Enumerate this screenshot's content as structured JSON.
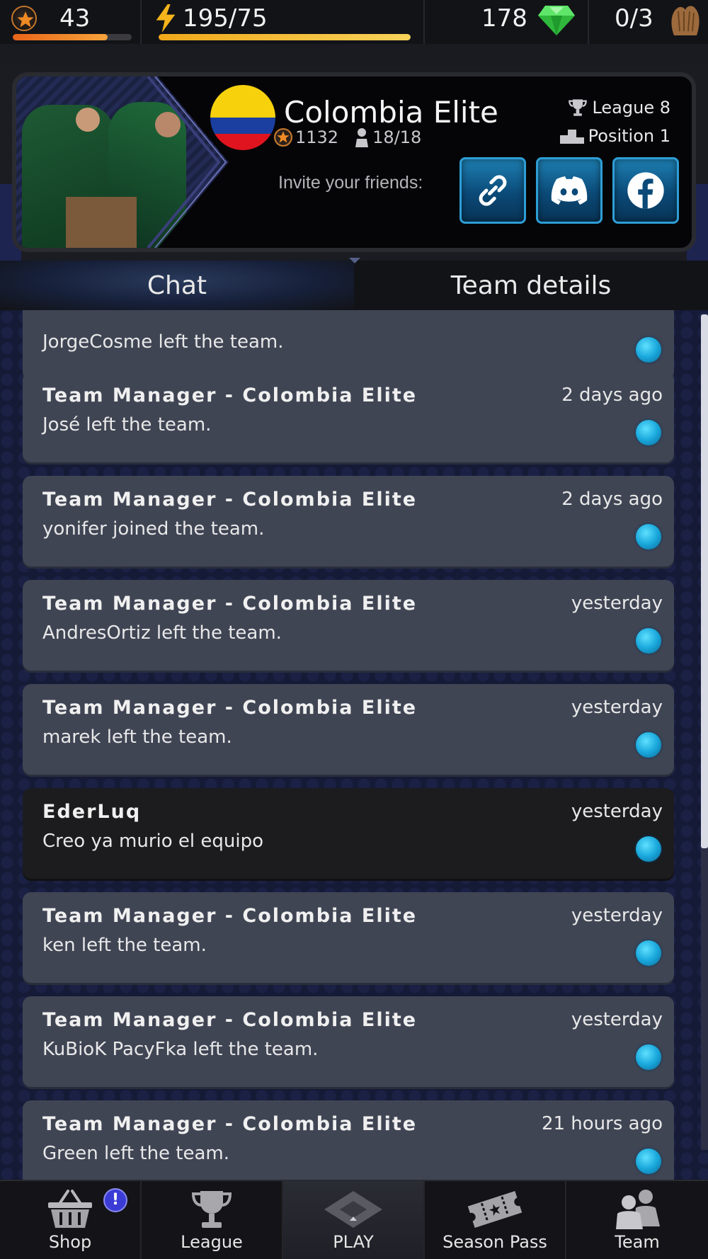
{
  "status_bar": {
    "level": "43",
    "level_progress": 0.8,
    "energy": "195/75",
    "energy_progress": 1.0,
    "gems": "178",
    "gloves": "0/3",
    "colors": {
      "level_bar": "#f07a1c",
      "energy_bar": "#f0b020",
      "gem": "#3cd04a"
    }
  },
  "team": {
    "name": "Colombia Elite",
    "rating": "1132",
    "members": "18/18",
    "league": "League 8",
    "position": "Position 1",
    "invite_label": "Invite your friends:",
    "share_buttons": [
      "link-icon",
      "discord-icon",
      "facebook-icon"
    ]
  },
  "tabs": [
    {
      "label": "Chat",
      "active": true
    },
    {
      "label": "Team details",
      "active": false
    }
  ],
  "messages": [
    {
      "author": "",
      "time": "",
      "text": "JorgeCosme left the team.",
      "kind": "system"
    },
    {
      "author": "Team Manager - Colombia Elite",
      "time": "2 days ago",
      "text": "José  left the team.",
      "kind": "system"
    },
    {
      "author": "Team Manager - Colombia Elite",
      "time": "2 days ago",
      "text": "yonifer  joined the team.",
      "kind": "system"
    },
    {
      "author": "Team Manager - Colombia Elite",
      "time": "yesterday",
      "text": "AndresOrtiz left the team.",
      "kind": "system"
    },
    {
      "author": "Team Manager - Colombia Elite",
      "time": "yesterday",
      "text": "marek left the team.",
      "kind": "system"
    },
    {
      "author": "EderLuq",
      "time": "yesterday",
      "text": "Creo ya murio el equipo",
      "kind": "player"
    },
    {
      "author": "Team Manager - Colombia Elite",
      "time": "yesterday",
      "text": "ken  left the team.",
      "kind": "system"
    },
    {
      "author": "Team Manager - Colombia Elite",
      "time": "yesterday",
      "text": "KuBioK PacyFka left the team.",
      "kind": "system"
    },
    {
      "author": "Team Manager - Colombia Elite",
      "time": "21 hours ago",
      "text": "Green left the team.",
      "kind": "system"
    }
  ],
  "nav": [
    {
      "label": "Shop",
      "icon": "basket-icon",
      "badge": "!"
    },
    {
      "label": "League",
      "icon": "trophy-icon"
    },
    {
      "label": "PLAY",
      "icon": "baseball-diamond-icon",
      "active": true
    },
    {
      "label": "Season Pass",
      "icon": "ticket-icon"
    },
    {
      "label": "Team",
      "icon": "team-icon"
    }
  ]
}
